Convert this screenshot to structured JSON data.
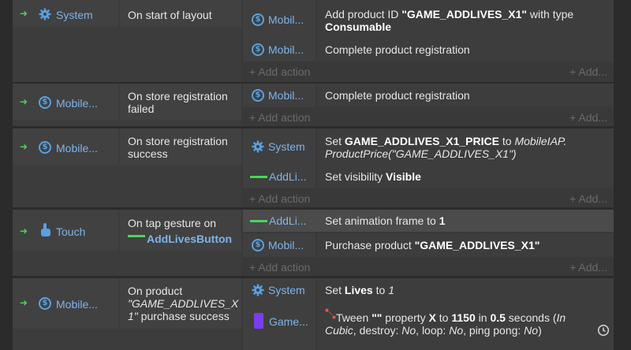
{
  "blocks": [
    {
      "condition": {
        "object": "System",
        "text": "On start of layout"
      },
      "actions": [
        {
          "object": "Mobil...",
          "text_pre": "Add product ID ",
          "id": "\"GAME_ADDLIVES_X1\"",
          "text_mid": " with type ",
          "type": "Consumable"
        },
        {
          "object": "Mobil...",
          "text": "Complete product registration"
        }
      ],
      "add_action": "+ Add action",
      "add": "+ Add..."
    },
    {
      "condition": {
        "object": "Mobile...",
        "text": "On store registration failed"
      },
      "actions": [
        {
          "object": "Mobil...",
          "text": "Complete product registration"
        }
      ],
      "add_action": "+ Add action",
      "add": "+ Add..."
    },
    {
      "condition": {
        "object": "Mobile...",
        "text": "On store registration success"
      },
      "actions": [
        {
          "object": "System",
          "text_pre": "Set ",
          "var": "GAME_ADDLIVES_X1_PRICE",
          "text_mid": " to ",
          "expr1": "MobileIAP.",
          "expr2": "ProductPrice(\"GAME_ADDLIVES_X1\")"
        },
        {
          "object": "AddLi...",
          "text_pre": "Set visibility ",
          "value": "Visible"
        }
      ],
      "add_action": "+ Add action",
      "add": "+ Add..."
    },
    {
      "condition": {
        "object": "Touch",
        "text": "On tap gesture on",
        "target": "AddLivesButton"
      },
      "actions": [
        {
          "object": "AddLi...",
          "text_pre": "Set animation frame to ",
          "value": "1"
        },
        {
          "object": "Mobil...",
          "text_pre": "Purchase product ",
          "value": "\"GAME_ADDLIVES_X1\""
        }
      ],
      "add_action": "+ Add action",
      "add": "+ Add..."
    },
    {
      "condition": {
        "object": "Mobile...",
        "text1": "On product",
        "text2": "\"GAME_ADDLIVES_X",
        "text3": "1\"",
        "text4": " purchase success"
      },
      "actions": [
        {
          "object": "System",
          "text_pre": "Set ",
          "var": "Lives",
          "text_mid": " to ",
          "value": "1"
        },
        {
          "object": "Game...",
          "tween_pre": " Tween ",
          "tween_name": "\"\"",
          "tween_prop": " property ",
          "prop": "X",
          "to": " to ",
          "to_val": "1150",
          "in": " in ",
          "secs": "0.5",
          "secs_label": " seconds (",
          "ease": "In",
          "line2_ease": "Cubic",
          "line2_rest": ", destroy: ",
          "destroy": "No",
          "loop_label": ", loop: ",
          "loop": "No",
          "pp_label": ", ping pong: ",
          "pp": "No",
          "close": ")"
        }
      ]
    }
  ]
}
